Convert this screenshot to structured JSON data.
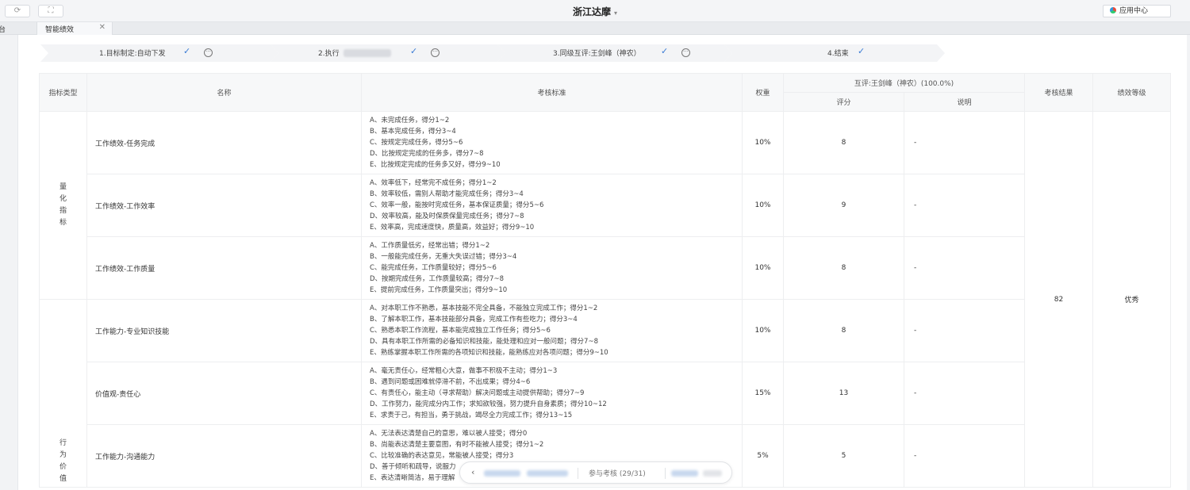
{
  "window": {
    "title": "浙江达摩",
    "title_caret": "▾",
    "refresh_icon": "refresh-icon",
    "fullscreen_icon": "fullscreen-icon",
    "app_center": "应用中心"
  },
  "tabs": {
    "prev_partial": "台",
    "active": "智能绩效",
    "close": "✕"
  },
  "steps": [
    {
      "label": "1.目标制定:自动下发",
      "check": "✓",
      "more": "···"
    },
    {
      "label": "2.执行",
      "check": "✓",
      "more": "···"
    },
    {
      "label": "3.同级互评:王剑峰（神农）",
      "check": "✓",
      "more": "···"
    },
    {
      "label": "4.结束",
      "check": "✓"
    }
  ],
  "table": {
    "headers": {
      "type": "指标类型",
      "name": "名称",
      "criteria": "考核标准",
      "weight": "权重",
      "peer_review": "互评:王剑峰（神农）(100.0%)",
      "score": "评分",
      "note": "说明",
      "result": "考核结果",
      "grade": "绩效等级"
    },
    "groups": [
      {
        "type_chars": [
          "量",
          "化",
          "指",
          "标"
        ]
      },
      {
        "type_chars": [
          "行",
          "为",
          "价",
          "值"
        ]
      }
    ],
    "rows": [
      {
        "name": "工作绩效-任务完成",
        "criteria": [
          "A、未完成任务，得分1~2",
          "B、基本完成任务，得分3~4",
          "C、按规定完成任务，得分5~6",
          "D、比按规定完成的任务多，得分7~8",
          "E、比按规定完成的任务多又好，得分9~10"
        ],
        "weight": "10%",
        "score": "8",
        "note": "-"
      },
      {
        "name": "工作绩效-工作效率",
        "criteria": [
          "A、效率低下，经常完不成任务；得分1~2",
          "B、效率较低，需别人帮助才能完成任务；得分3~4",
          "C、效率一般，能按时完成任务，基本保证质量；得分5~6",
          "D、效率较高，能及时保质保量完成任务；得分7~8",
          "E、效率高，完成速度快，质量高，效益好；得分9~10"
        ],
        "weight": "10%",
        "score": "9",
        "note": "-"
      },
      {
        "name": "工作绩效-工作质量",
        "criteria": [
          "A、工作质量低劣，经常出错；得分1~2",
          "B、一般能完成任务，无重大失误过错；得分3~4",
          "C、能完成任务，工作质量较好；得分5~6",
          "D、按期完成任务，工作质量较高；得分7~8",
          "E、提前完成任务，工作质量突出；得分9~10"
        ],
        "weight": "10%",
        "score": "8",
        "note": "-"
      },
      {
        "name": "工作能力-专业知识技能",
        "criteria": [
          "A、对本职工作不熟悉，基本技能不完全具备，不能独立完成工作；得分1~2",
          "B、了解本职工作，基本技能部分具备，完成工作有些吃力；得分3~4",
          "C、熟悉本职工作流程，基本能完成独立工作任务；得分5~6",
          "D、具有本职工作所需的必备知识和技能，能处理和应对一般问题；得分7~8",
          "E、熟练掌握本职工作所需的各项知识和技能，能熟练应对各项问题；得分9~10"
        ],
        "weight": "10%",
        "score": "8",
        "note": "-"
      },
      {
        "name": "价值观-责任心",
        "criteria": [
          "A、毫无责任心，经常粗心大意，做事不积极不主动；得分1~3",
          "B、遇到问题或困难就停滞不前，不出成果；得分4~6",
          "C、有责任心，能主动（寻求帮助）解决问题或主动提供帮助；得分7~9",
          "D、工作努力，能完成分内工作；求知欲较强，努力提升自身素质；得分10~12",
          "E、求责于己，有担当，勇于挑战，竭尽全力完成工作；得分13~15"
        ],
        "weight": "15%",
        "score": "13",
        "note": "-"
      },
      {
        "name": "工作能力-沟通能力",
        "criteria": [
          "A、无法表达清楚自己的意思，难以被人接受；得分0",
          "B、尚能表达清楚主要意图，有时不能被人接受；得分1~2",
          "C、比较准确的表达意见，常能被人接受；得分3",
          "D、善于倾听和疏导，说服力",
          "E、表达清晰简洁，易于理解"
        ],
        "weight": "5%",
        "score": "5",
        "note": "-"
      }
    ],
    "result": "82",
    "grade": "优秀"
  },
  "pager": {
    "arrow": "‹",
    "text": "参与考核 (29/31)"
  }
}
